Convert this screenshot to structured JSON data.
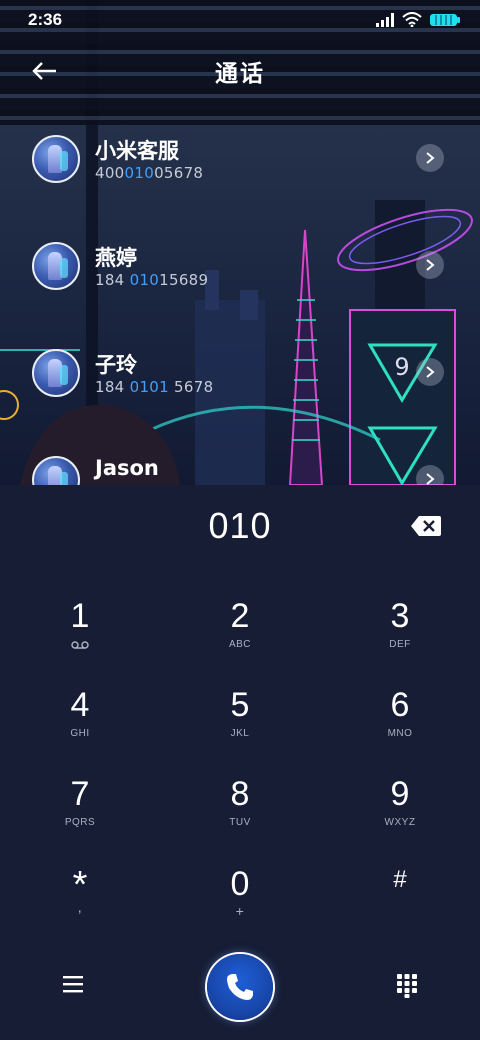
{
  "status_bar": {
    "time": "2:36"
  },
  "header": {
    "title": "通话"
  },
  "contacts": [
    {
      "name": "小米客服",
      "number_before": "400",
      "number_match": "010",
      "number_after": "05678"
    },
    {
      "name": "燕婷",
      "number_before": "184 ",
      "number_match": "010",
      "number_after": "15689"
    },
    {
      "name": "子玲",
      "number_before": "184 ",
      "number_match": "0101",
      "number_after": " 5678"
    },
    {
      "name": "Jason",
      "number_before": "",
      "number_match": "",
      "number_after": ""
    }
  ],
  "dialer": {
    "input": "010",
    "keys": [
      {
        "digit": "1",
        "sub": ""
      },
      {
        "digit": "2",
        "sub": "ABC"
      },
      {
        "digit": "3",
        "sub": "DEF"
      },
      {
        "digit": "4",
        "sub": "GHI"
      },
      {
        "digit": "5",
        "sub": "JKL"
      },
      {
        "digit": "6",
        "sub": "MNO"
      },
      {
        "digit": "7",
        "sub": "PQRS"
      },
      {
        "digit": "8",
        "sub": "TUV"
      },
      {
        "digit": "9",
        "sub": "WXYZ"
      },
      {
        "digit": "*",
        "sub": ","
      },
      {
        "digit": "0",
        "sub": "+"
      },
      {
        "digit": "#",
        "sub": ""
      }
    ]
  },
  "icons": {
    "back": "arrow-left-icon",
    "delete": "backspace-icon",
    "voicemail": "voicemail-icon",
    "menu": "menu-icon",
    "call": "phone-icon",
    "keypad": "keypad-icon"
  },
  "colors": {
    "accent": "#3ea0ff",
    "call_button": "#1845a8",
    "dialer_bg": "#161d35"
  }
}
